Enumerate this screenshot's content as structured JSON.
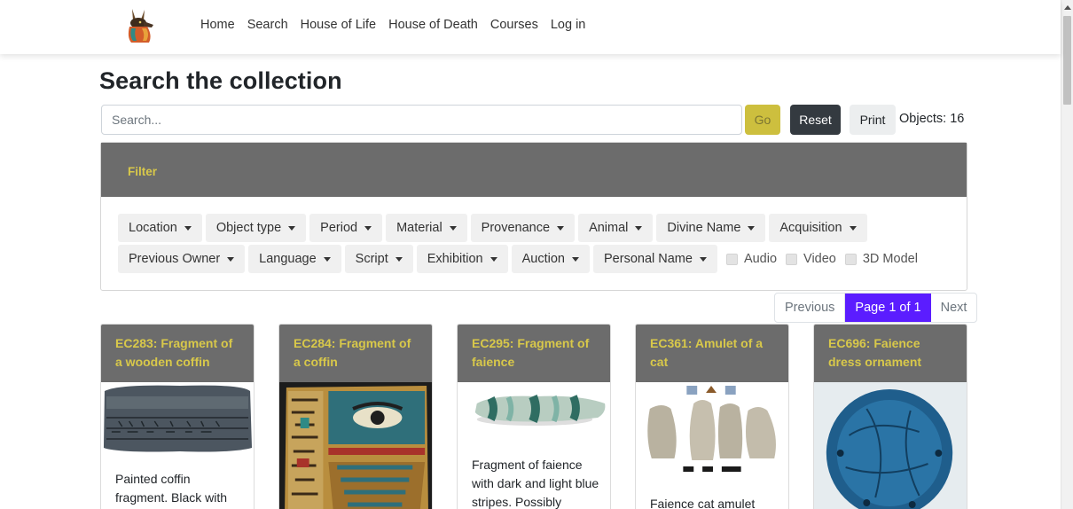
{
  "nav": {
    "logo_icon": "anubis-jackal-logo-icon",
    "links": [
      "Home",
      "Search",
      "House of Life",
      "House of Death",
      "Courses",
      "Log in"
    ]
  },
  "search": {
    "title": "Search the collection",
    "placeholder": "Search...",
    "go_label": "Go",
    "reset_label": "Reset",
    "print_label": "Print",
    "objects_count": "Objects: 16"
  },
  "filter": {
    "title": "Filter",
    "row1": [
      "Location",
      "Object type",
      "Period",
      "Material",
      "Provenance",
      "Animal",
      "Divine Name",
      "Acquisition"
    ],
    "row2": [
      "Previous Owner",
      "Language",
      "Script",
      "Exhibition",
      "Auction",
      "Personal Name"
    ],
    "checkboxes": [
      "Audio",
      "Video",
      "3D Model"
    ]
  },
  "pagination": {
    "previous": "Previous",
    "current": "Page 1 of 1",
    "next": "Next"
  },
  "cards": [
    {
      "title": "EC283: Fragment of a wooden coffin",
      "text": "Painted coffin fragment. Black with"
    },
    {
      "title": "EC284: Fragment of a coffin",
      "text": ""
    },
    {
      "title": "EC295: Fragment of faience",
      "text": "Fragment of faience with dark and light blue stripes. Possibly"
    },
    {
      "title": "EC361: Amulet of a cat",
      "text": "Faience cat amulet"
    },
    {
      "title": "EC696: Faience dress ornament",
      "text": ""
    }
  ],
  "colors": {
    "accent_gold": "#d8c84a",
    "header_gray": "#6c6c6c",
    "pagination_active": "#5b1dff",
    "reset_dark": "#343a40"
  }
}
